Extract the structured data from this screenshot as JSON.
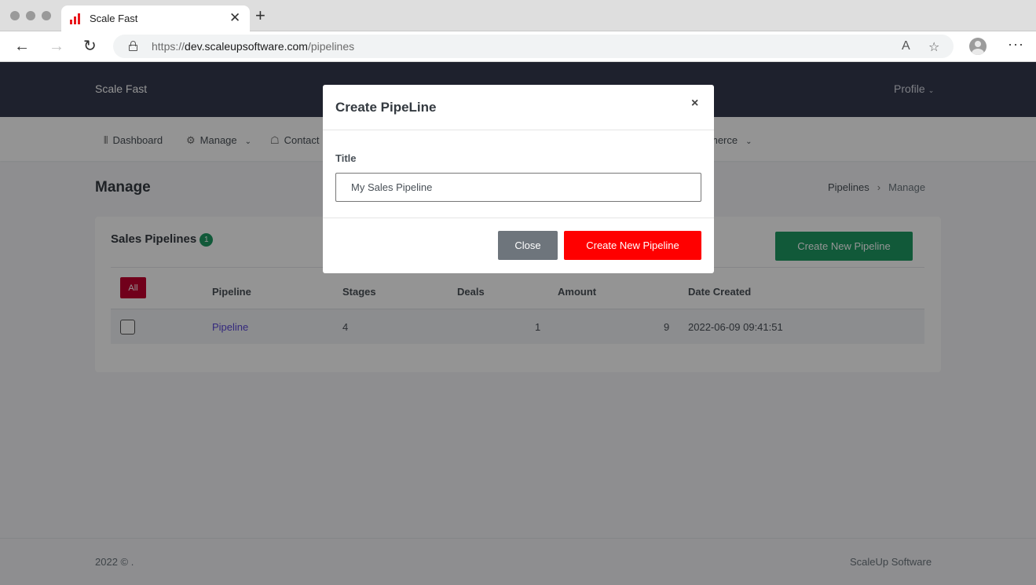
{
  "browser": {
    "tab_title": "Scale Fast",
    "tab_close": "✕",
    "new_tab": "+",
    "url_scheme": "https://",
    "url_host": "dev.scaleupsoftware.com",
    "url_path": "/pipelines",
    "back": "←",
    "forward": "→",
    "reload": "↻",
    "read_aloud": "A",
    "favorites": "☆",
    "more": "···"
  },
  "header": {
    "brand": "Scale Fast",
    "profile": "Profile",
    "profile_chevron": "⌄"
  },
  "nav": {
    "items": [
      {
        "label": "Dashboard",
        "icon": "bar-chart-icon",
        "glyph": "⫴"
      },
      {
        "label": "Manage",
        "icon": "gear-icon",
        "glyph": "⚙",
        "chevron": "⌄"
      },
      {
        "label": "Contact",
        "icon": "contact-icon",
        "glyph": "☖"
      },
      {
        "label": "merce",
        "chevron": "⌄"
      }
    ]
  },
  "page": {
    "title": "Manage",
    "breadcrumb": [
      "Pipelines",
      "Manage"
    ],
    "breadcrumb_sep": "›"
  },
  "card": {
    "title": "Sales Pipelines",
    "count": "1",
    "create_button": "Create New Pipeline",
    "all_button": "All",
    "columns": [
      "Pipeline",
      "Stages",
      "Deals",
      "Amount",
      "Date Created"
    ],
    "rows": [
      {
        "pipeline": "Pipeline",
        "stages": "4",
        "deals": "1",
        "amount": "9",
        "date_created": "2022-06-09 09:41:51"
      }
    ]
  },
  "footer": {
    "left": "2022 © .",
    "right": "ScaleUp Software"
  },
  "modal": {
    "title": "Create PipeLine",
    "close_x": "×",
    "field_label": "Title",
    "field_value": "My Sales Pipeline",
    "close_button": "Close",
    "create_button": "Create New Pipeline"
  },
  "colors": {
    "header_bg": "#343a4f",
    "success": "#1e9a63",
    "danger": "#c3002f",
    "primary_red": "#ff0000",
    "secondary": "#6e757c",
    "link": "#5a47d8"
  }
}
